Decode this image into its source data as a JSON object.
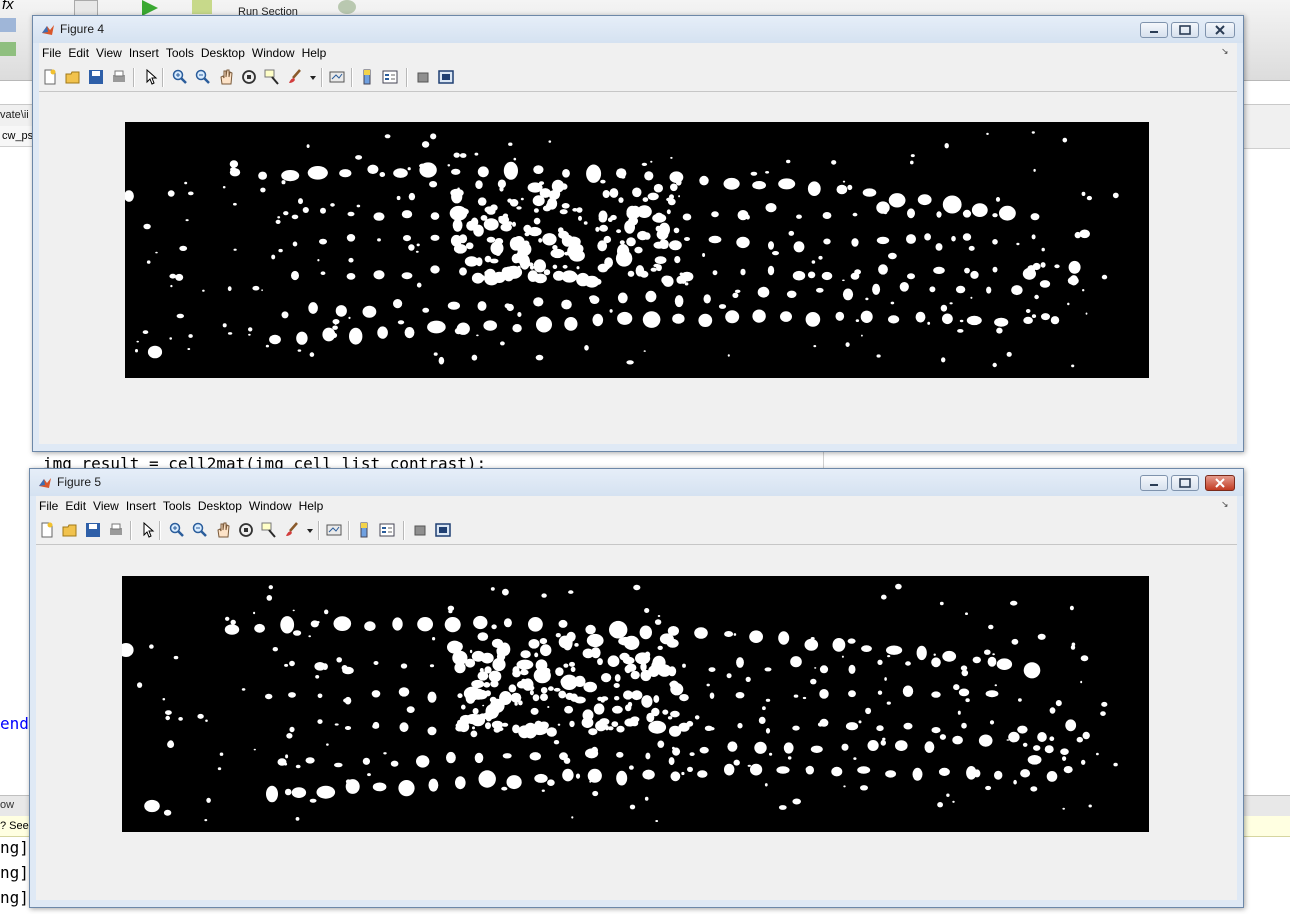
{
  "background": {
    "toolstrip_label": "Run Section",
    "path_fragment": "vate\\ii",
    "file_tab": "cw_ps",
    "editor_line": "img_result = cell2mat(img_cell_list_contrast);",
    "end_keyword": "end",
    "command_title": "ow",
    "notice_fragment": "? See",
    "command_lines": [
      "ng]",
      "ng]",
      "ng]"
    ]
  },
  "windows": [
    {
      "title": "Figure 4"
    },
    {
      "title": "Figure 5"
    }
  ],
  "menu": [
    "File",
    "Edit",
    "View",
    "Insert",
    "Tools",
    "Desktop",
    "Window",
    "Help"
  ],
  "toolbar_icons": [
    "new-figure-icon",
    "open-file-icon",
    "save-icon",
    "print-icon",
    "edit-plot-icon",
    "zoom-in-icon",
    "zoom-out-icon",
    "pan-icon",
    "rotate-3d-icon",
    "data-cursor-icon",
    "brush-icon",
    "brush-dropdown-icon",
    "link-plot-icon",
    "insert-colorbar-icon",
    "insert-legend-icon",
    "hide-plot-tools-icon",
    "show-plot-tools-icon"
  ],
  "colors": {
    "figure_bg": "#f0f0f0",
    "image_bg": "#000000",
    "blob": "#ffffff",
    "close_active": "#c23b22",
    "editor_keyword": "#0000ff"
  }
}
